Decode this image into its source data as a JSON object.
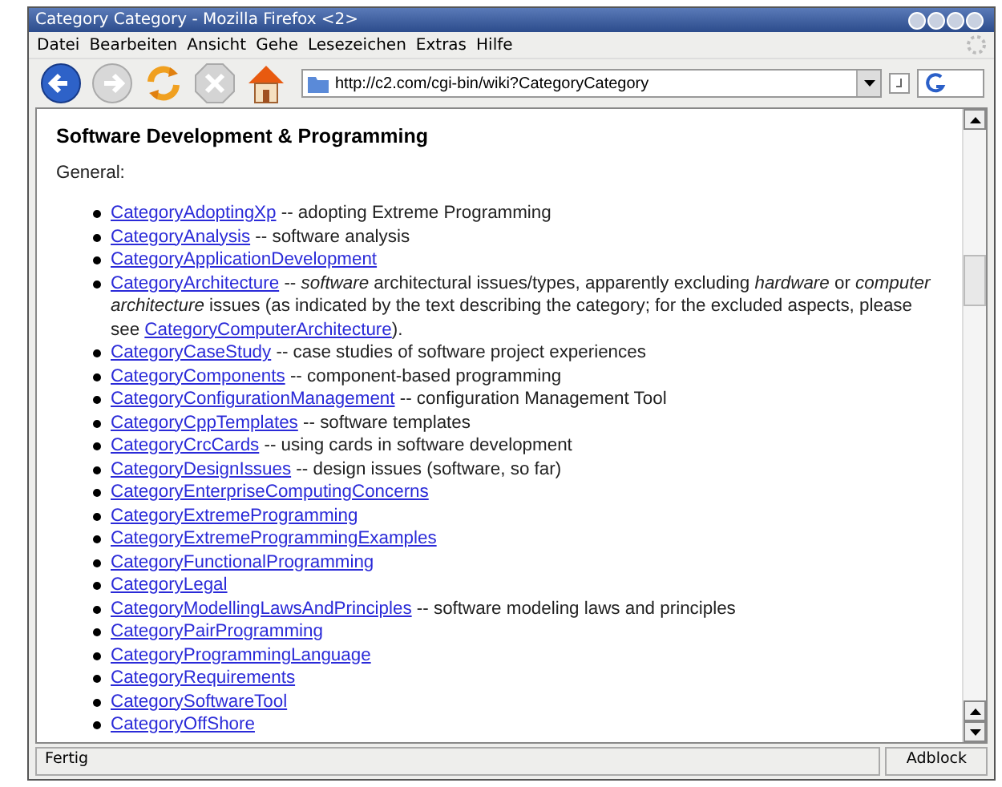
{
  "window": {
    "title": "Category Category - Mozilla Firefox <2>"
  },
  "menu": [
    "Datei",
    "Bearbeiten",
    "Ansicht",
    "Gehe",
    "Lesezeichen",
    "Extras",
    "Hilfe"
  ],
  "toolbar": {
    "url": "http://c2.com/cgi-bin/wiki?CategoryCategory"
  },
  "page": {
    "heading": "Software Development & Programming",
    "intro": "General:",
    "items": [
      {
        "link": "CategoryAdoptingXp",
        "description": "-- adopting Extreme Programming"
      },
      {
        "link": "CategoryAnalysis",
        "description": "-- software analysis"
      },
      {
        "link": "CategoryApplicationDevelopment"
      },
      {
        "link": "CategoryArchitecture",
        "description": "-- *software* architectural issues/types, apparently excluding *hardware* or *computer architecture* issues (as indicated by the text describing the category; for the excluded aspects, please see",
        "inner_link": "CategoryComputerArchitecture",
        "tail": ")."
      },
      {
        "link": "CategoryCaseStudy",
        "description": "-- case studies of software project experiences"
      },
      {
        "link": "CategoryComponents",
        "description": "-- component-based programming"
      },
      {
        "link": "CategoryConfigurationManagement",
        "description": "-- configuration Management Tool"
      },
      {
        "link": "CategoryCppTemplates",
        "description": "-- software templates"
      },
      {
        "link": "CategoryCrcCards",
        "description": "-- using cards in software development"
      },
      {
        "link": "CategoryDesignIssues",
        "description": "-- design issues (software, so far)"
      },
      {
        "link": "CategoryEnterpriseComputingConcerns"
      },
      {
        "link": "CategoryExtremeProgramming"
      },
      {
        "link": "CategoryExtremeProgrammingExamples"
      },
      {
        "link": "CategoryFunctionalProgramming"
      },
      {
        "link": "CategoryLegal"
      },
      {
        "link": "CategoryModellingLawsAndPrinciples",
        "description": "-- software modeling laws and principles"
      },
      {
        "link": "CategoryPairProgramming"
      },
      {
        "link": "CategoryProgrammingLanguage"
      },
      {
        "link": "CategoryRequirements"
      },
      {
        "link": "CategorySoftwareTool"
      },
      {
        "link": "CategoryOffShore"
      }
    ]
  },
  "status_bar": {
    "text": "Fertig",
    "adblock": "Adblock"
  }
}
